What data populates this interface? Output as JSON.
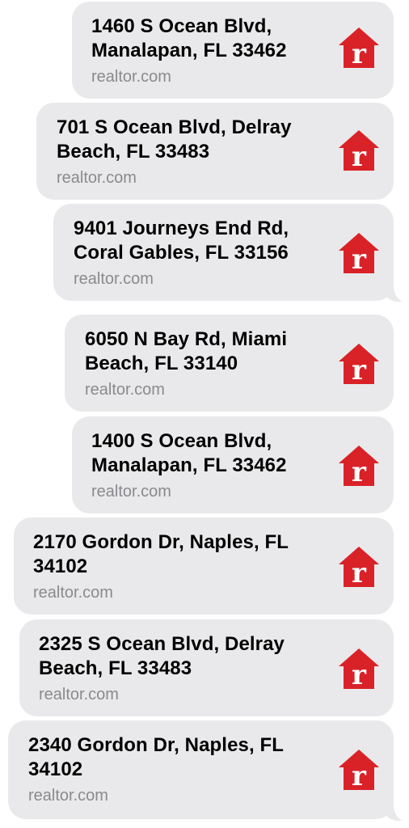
{
  "messages": [
    {
      "address": "1460 S Ocean Blvd, Manalapan, FL 33462",
      "line1": "1460 S Ocean Blvd,",
      "line2": "Manalapan, FL 33462",
      "domain": "realtor.com",
      "logo_icon": "realtor-house-icon"
    },
    {
      "address": "701 S Ocean Blvd, Delray Beach, FL 33483",
      "line1": "701 S Ocean Blvd, Delray",
      "line2": "Beach, FL 33483",
      "domain": "realtor.com",
      "logo_icon": "realtor-house-icon"
    },
    {
      "address": "9401 Journeys End Rd, Coral Gables, FL 33156",
      "line1": "9401 Journeys End Rd,",
      "line2": "Coral Gables, FL 33156",
      "domain": "realtor.com",
      "logo_icon": "realtor-house-icon"
    },
    {
      "address": "6050 N Bay Rd, Miami Beach, FL 33140",
      "line1": "6050 N Bay Rd, Miami",
      "line2": "Beach, FL 33140",
      "domain": "realtor.com",
      "logo_icon": "realtor-house-icon"
    },
    {
      "address": "1400 S Ocean Blvd, Manalapan, FL 33462",
      "line1": "1400 S Ocean Blvd,",
      "line2": "Manalapan, FL 33462",
      "domain": "realtor.com",
      "logo_icon": "realtor-house-icon"
    },
    {
      "address": "2170 Gordon Dr, Naples, FL 34102",
      "line1": "2170 Gordon Dr, Naples, FL",
      "line2": "34102",
      "domain": "realtor.com",
      "logo_icon": "realtor-house-icon"
    },
    {
      "address": "2325 S Ocean Blvd, Delray Beach, FL 33483",
      "line1": "2325 S Ocean Blvd, Delray",
      "line2": "Beach, FL 33483",
      "domain": "realtor.com",
      "logo_icon": "realtor-house-icon"
    },
    {
      "address": "2340 Gordon Dr, Naples, FL 34102",
      "line1": "2340 Gordon Dr, Naples, FL",
      "line2": "34102",
      "domain": "realtor.com",
      "logo_icon": "realtor-house-icon"
    }
  ],
  "colors": {
    "bubble": "#e9e9eb",
    "brand_red": "#d92228",
    "domain_text": "#8a8a8e"
  }
}
